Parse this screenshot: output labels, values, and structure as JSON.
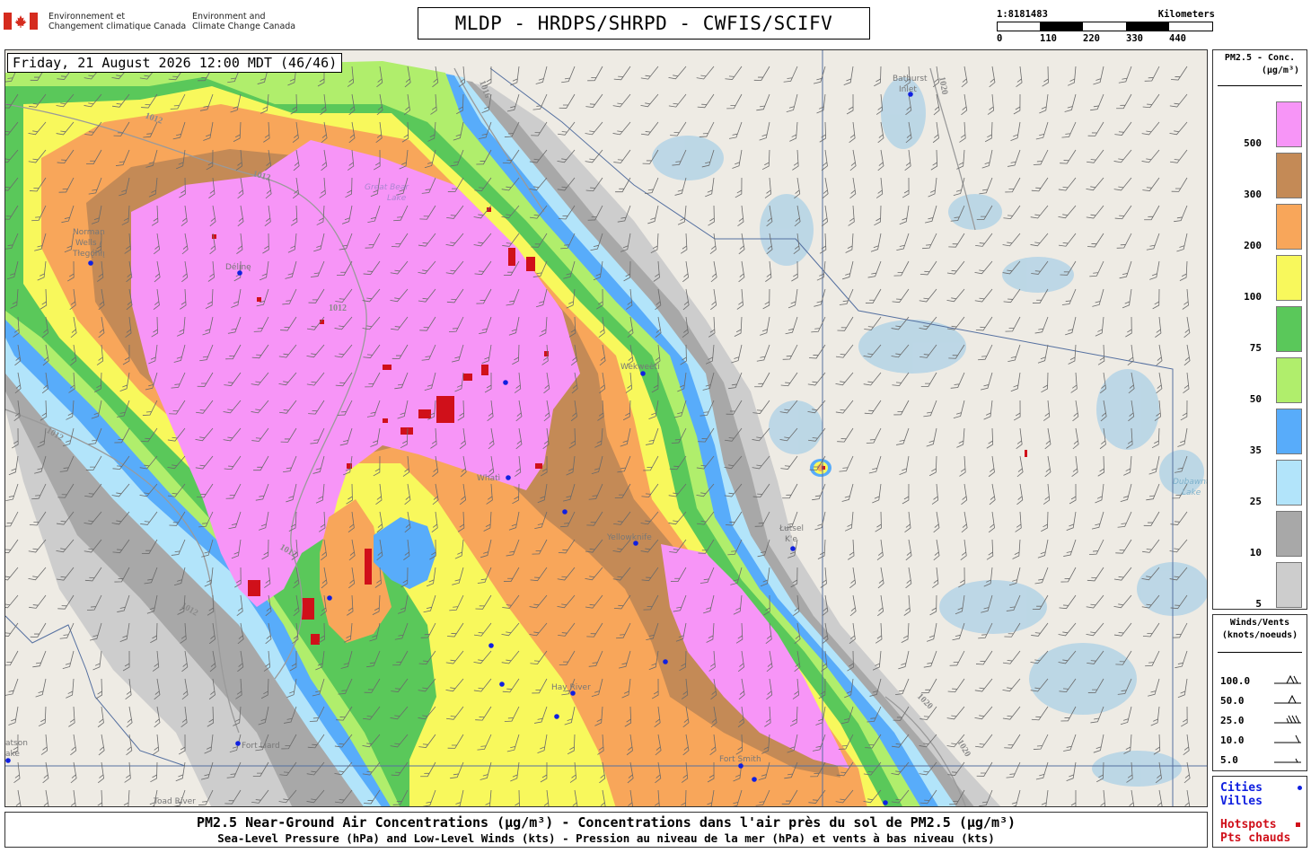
{
  "header": {
    "agency_fr_1": "Environnement et",
    "agency_fr_2": "Changement climatique Canada",
    "agency_en_1": "Environment and",
    "agency_en_2": "Climate Change Canada",
    "title": "MLDP - HRDPS/SHRPD - CWFIS/SCIFV"
  },
  "scale": {
    "ratio": "1:8181483",
    "unit": "Kilometers",
    "ticks": [
      "0",
      "110",
      "220",
      "330",
      "440"
    ]
  },
  "map": {
    "timestamp": "Friday, 21 August 2026 12:00 MDT (46/46)",
    "isobar_labels": [
      "1012",
      "1012",
      "1012",
      "1012",
      "1012",
      "1012",
      "1016",
      "1020",
      "1020",
      "1020"
    ],
    "cities": [
      {
        "name": "Norman Wells / Tłegǫ́hłı̨",
        "lines": [
          "Norman",
          "Wells /",
          "Tłegǫ́hłı̨"
        ]
      },
      {
        "name": "Délı̨nę",
        "lines": [
          "Délı̨nę"
        ]
      },
      {
        "name": "Wekweètì",
        "lines": [
          "Wekweètì"
        ]
      },
      {
        "name": "Whatì",
        "lines": [
          "Whatì"
        ]
      },
      {
        "name": "Yellowknife",
        "lines": [
          "Yellowknife"
        ]
      },
      {
        "name": "Łutsel K'e",
        "lines": [
          "Łutsel",
          "K'e"
        ]
      },
      {
        "name": "Hay River",
        "lines": [
          "Hay River"
        ]
      },
      {
        "name": "Fort Liard",
        "lines": [
          "Fort Liard"
        ]
      },
      {
        "name": "Fort Smith",
        "lines": [
          "Fort Smith"
        ]
      },
      {
        "name": "Bathurst Inlet",
        "lines": [
          "Bathurst",
          "Inlet"
        ]
      },
      {
        "name": "Watson Lake",
        "lines": [
          "atson",
          "ake"
        ]
      },
      {
        "name": "Toad River",
        "lines": [
          "Toad River"
        ]
      },
      {
        "name": "Dubawnt Lake",
        "lines": [
          "Dubawnt",
          "Lake"
        ]
      },
      {
        "name": "Great Bear Lake",
        "lines": [
          "Great Bear",
          "Lake"
        ]
      }
    ]
  },
  "legend": {
    "title_1": "PM2.5 - Conc.",
    "title_2": "(µg/m³)",
    "bins": [
      {
        "label": "500",
        "color": "#f795f7"
      },
      {
        "label": "300",
        "color": "#c48a56"
      },
      {
        "label": "200",
        "color": "#f8a65a"
      },
      {
        "label": "100",
        "color": "#f8f85c"
      },
      {
        "label": "75",
        "color": "#5ac85a"
      },
      {
        "label": "50",
        "color": "#b0ee6c"
      },
      {
        "label": "35",
        "color": "#58acfa"
      },
      {
        "label": "25",
        "color": "#b2e4fa"
      },
      {
        "label": "10",
        "color": "#a8a8a8"
      },
      {
        "label": "5",
        "color": "#cdcdcd"
      }
    ]
  },
  "wind_legend": {
    "title_1": "Winds/Vents",
    "title_2": "(knots/noeuds)",
    "speeds": [
      "100.0",
      "50.0",
      "25.0",
      "10.0",
      "5.0"
    ]
  },
  "symbols": {
    "cities_en": "Cities",
    "cities_fr": "Villes",
    "hotspots_en": "Hotspots",
    "hotspots_fr": "Pts chauds",
    "city_color": "#1020e0",
    "hotspot_color": "#d0101a"
  },
  "caption": {
    "line1": "PM2.5 Near-Ground Air Concentrations (µg/m³) - Concentrations dans l'air près du sol de PM2.5 (µg/m³)",
    "line2": "Sea-Level Pressure (hPa) and Low-Level Winds (kts) - Pression au niveau de la mer (hPa) et vents à bas niveau (kts)"
  }
}
